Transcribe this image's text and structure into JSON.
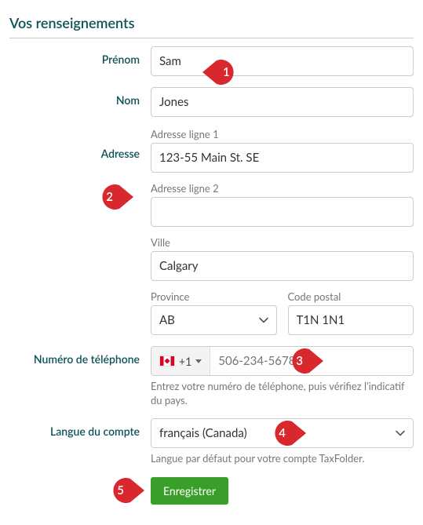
{
  "title": "Vos renseignements",
  "labels": {
    "prenom": "Prénom",
    "nom": "Nom",
    "adresse": "Adresse",
    "adresse1": "Adresse ligne 1",
    "adresse2": "Adresse ligne 2",
    "ville": "Ville",
    "province": "Province",
    "postal": "Code postal",
    "phone": "Numéro de téléphone",
    "phone_help": "Entrez votre numéro de téléphone, puis vérifiez l'indicatif du pays.",
    "lang": "Langue du compte",
    "lang_help": "Langue par défaut pour votre compte TaxFolder.",
    "save": "Enregistrer"
  },
  "values": {
    "prenom": "Sam",
    "nom": "Jones",
    "adresse1": "123-55 Main St. SE",
    "adresse2": "",
    "ville": "Calgary",
    "province": "AB",
    "postal": "T1N 1N1",
    "phone_prefix": "+1",
    "phone_placeholder": "506-234-5678",
    "lang": "français (Canada)"
  },
  "callouts": {
    "c1": "1",
    "c2": "2",
    "c3": "3",
    "c4": "4",
    "c5": "5"
  }
}
